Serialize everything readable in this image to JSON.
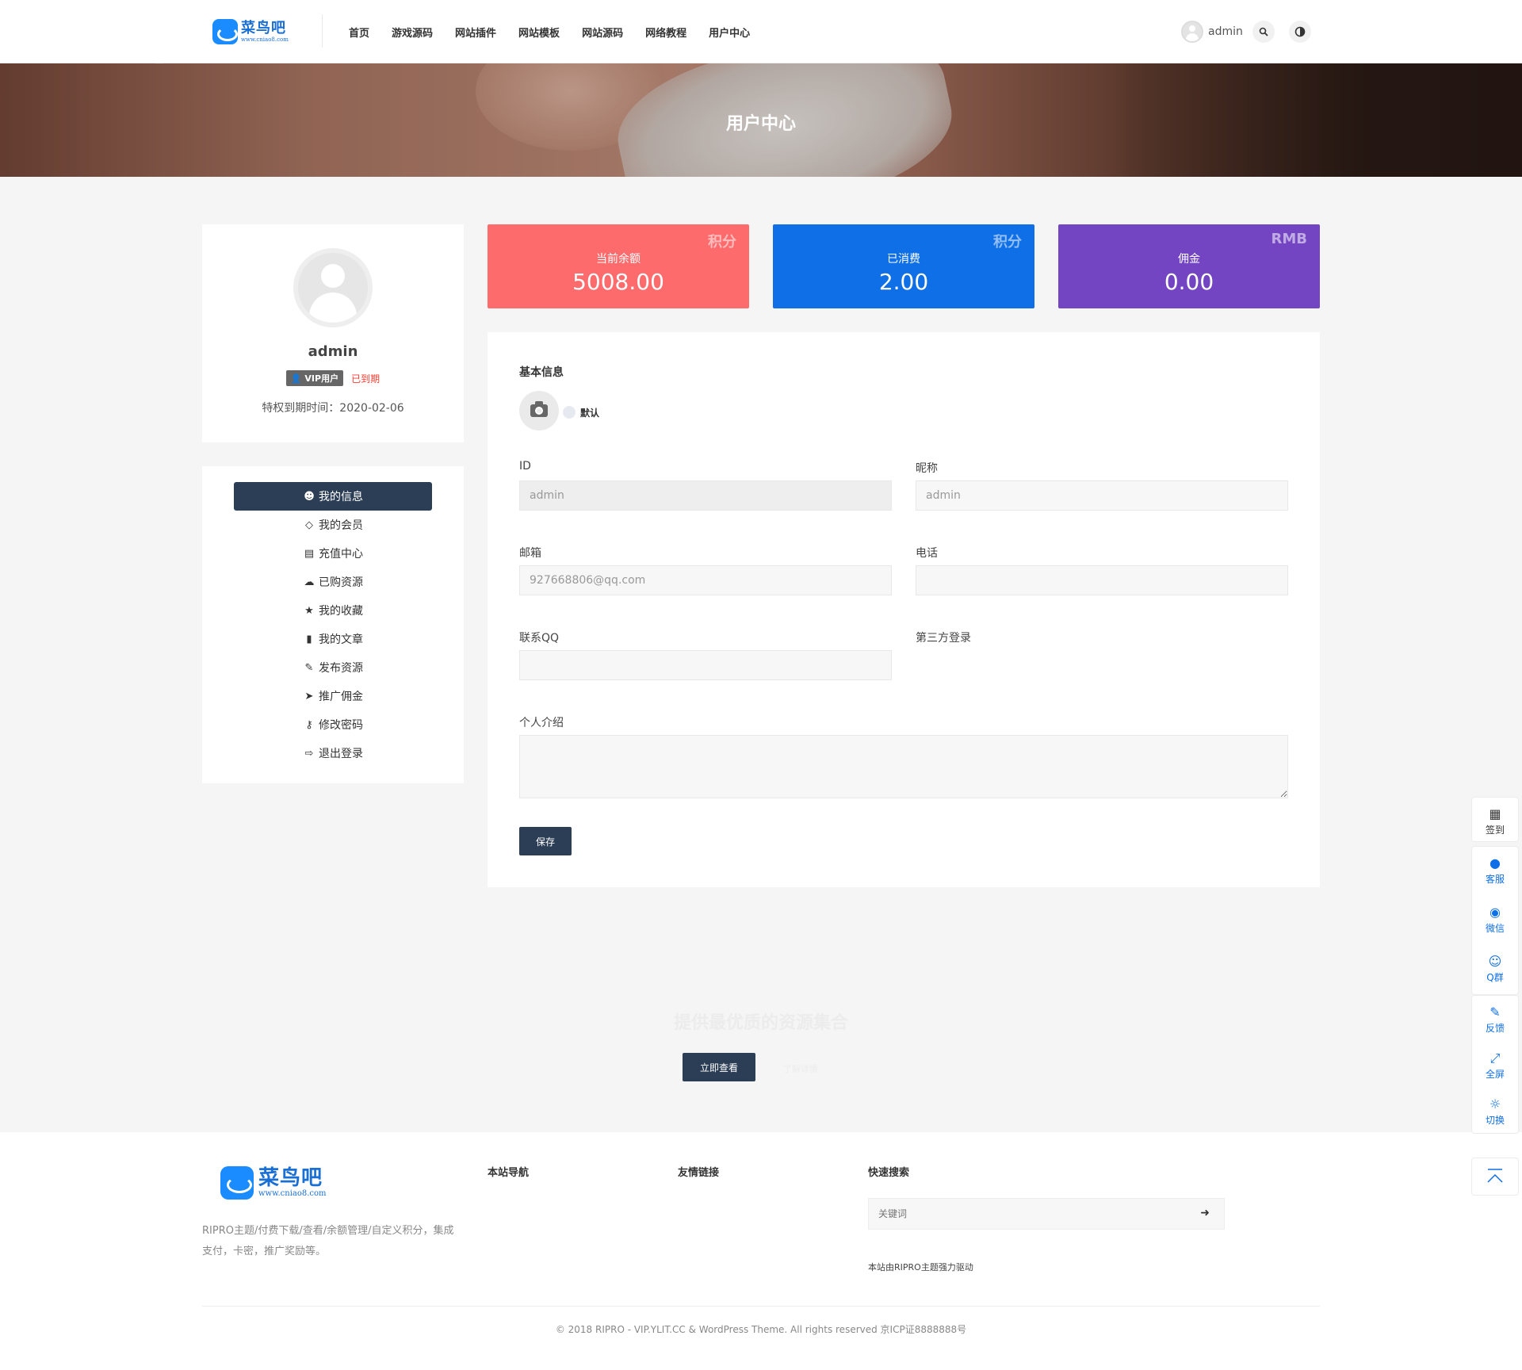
{
  "brand": {
    "name": "菜鸟吧",
    "url": "www.cniao8.com",
    "accent": "#1a8cff",
    "dark": "#2c3e56"
  },
  "nav": [
    "首页",
    "游戏源码",
    "网站插件",
    "网站模板",
    "网站源码",
    "网络教程",
    "用户中心"
  ],
  "header": {
    "username": "admin",
    "search_icon": "search-icon",
    "theme_icon": "contrast-icon"
  },
  "hero": {
    "title": "用户中心"
  },
  "profile": {
    "name": "admin",
    "vip_badge": "VIP用户",
    "vip_status": "已到期",
    "expiry": "特权到期时间：2020-02-06"
  },
  "menu": [
    {
      "label": "我的信息",
      "icon": "user-icon",
      "active": true
    },
    {
      "label": "我的会员",
      "icon": "diamond-icon"
    },
    {
      "label": "充值中心",
      "icon": "credit-card-icon"
    },
    {
      "label": "已购资源",
      "icon": "cloud-download-icon"
    },
    {
      "label": "我的收藏",
      "icon": "star-icon"
    },
    {
      "label": "我的文章",
      "icon": "document-icon"
    },
    {
      "label": "发布资源",
      "icon": "pencil-icon"
    },
    {
      "label": "推广佣金",
      "icon": "paper-plane-icon"
    },
    {
      "label": "修改密码",
      "icon": "key-icon"
    },
    {
      "label": "退出登录",
      "icon": "sign-out-icon"
    }
  ],
  "stats": [
    {
      "unit": "积分",
      "label": "当前余额",
      "value": "5008.00",
      "color": "#fd6b6d"
    },
    {
      "unit": "积分",
      "label": "已消费",
      "value": "2.00",
      "color": "#0e6fe6"
    },
    {
      "unit": "RMB",
      "label": "佣金",
      "value": "0.00",
      "color": "#7345c2"
    }
  ],
  "form": {
    "section_title": "基本信息",
    "avatar_default_label": "默认",
    "id_label": "ID",
    "id_value": "admin",
    "nickname_label": "昵称",
    "nickname_value": "admin",
    "email_label": "邮箱",
    "email_value": "927668806@qq.com",
    "phone_label": "电话",
    "phone_value": "",
    "qq_label": "联系QQ",
    "qq_value": "",
    "third_party_label": "第三方登录",
    "bio_label": "个人介绍",
    "bio_value": "",
    "save_label": "保存"
  },
  "cta": {
    "text": "提供最优质的资源集合",
    "button": "立即查看",
    "link": "了解详情"
  },
  "footer": {
    "desc": "RIPRO主题/付费下载/查看/余额管理/自定义积分，集成支付，卡密，推广奖励等。",
    "col_nav": "本站导航",
    "col_links": "友情链接",
    "col_search": "快速搜索",
    "search_placeholder": "关键词",
    "powered": "本站由RIPRO主题强力驱动",
    "copyright": "© 2018 RIPRO - VIP.YLIT.CC & WordPress Theme. All rights reserved 京ICP证8888888号"
  },
  "side_toolbar": [
    {
      "label": "签到",
      "icon": "calendar-icon"
    },
    {
      "label": "客服",
      "icon": "qq-icon"
    },
    {
      "label": "微信",
      "icon": "wechat-icon"
    },
    {
      "label": "Q群",
      "icon": "group-icon"
    },
    {
      "label": "反馈",
      "icon": "edit-icon"
    },
    {
      "label": "全屏",
      "icon": "fullscreen-icon"
    },
    {
      "label": "切换",
      "icon": "sun-icon"
    }
  ],
  "back_to_top_icon": "arrow-up-icon"
}
